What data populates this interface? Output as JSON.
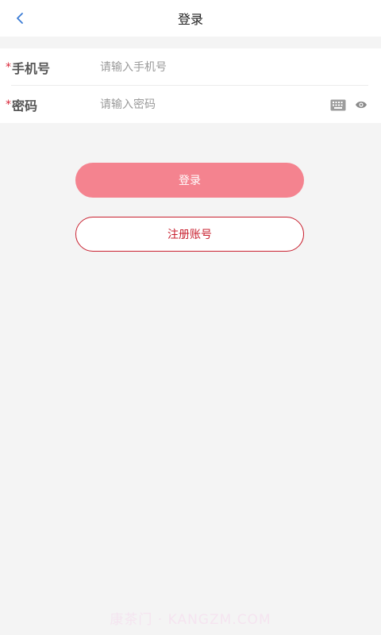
{
  "header": {
    "title": "登录"
  },
  "form": {
    "required_mark": "*",
    "phone_label": "手机号",
    "phone_placeholder": "请输入手机号",
    "password_label": "密码",
    "password_placeholder": "请输入密码"
  },
  "buttons": {
    "login_label": "登录",
    "register_label": "注册账号"
  },
  "watermark": "康茶门 · KANGZM.COM",
  "colors": {
    "primary": "#f4838f",
    "accent_red": "#c8202f",
    "back_icon": "#3a7bd5",
    "background": "#f4f4f4"
  },
  "icons": [
    "back-arrow-icon",
    "keyboard-icon",
    "eye-icon"
  ]
}
